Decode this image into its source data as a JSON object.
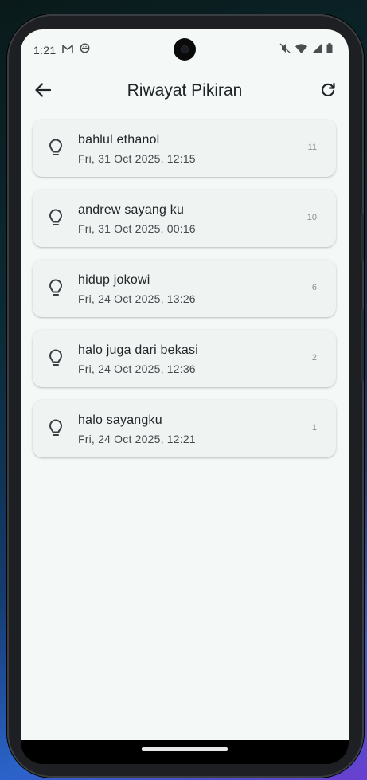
{
  "status_bar": {
    "time": "1:21"
  },
  "app_bar": {
    "title": "Riwayat Pikiran"
  },
  "thoughts": [
    {
      "title": "bahlul ethanol",
      "date": "Fri, 31 Oct 2025, 12:15",
      "count": "11"
    },
    {
      "title": "andrew sayang ku",
      "date": "Fri, 31 Oct 2025, 00:16",
      "count": "10"
    },
    {
      "title": "hidup jokowi",
      "date": "Fri, 24 Oct 2025, 13:26",
      "count": "6"
    },
    {
      "title": "halo juga dari bekasi",
      "date": "Fri, 24 Oct 2025, 12:36",
      "count": "2"
    },
    {
      "title": "halo sayangku",
      "date": "Fri, 24 Oct 2025, 12:21",
      "count": "1"
    }
  ],
  "icons": {
    "back": "arrow-left-icon",
    "refresh": "refresh-icon",
    "item": "lightbulb-icon",
    "status": [
      "gmail-icon",
      "android-icon",
      "mute-icon",
      "wifi-icon",
      "signal-icon",
      "battery-icon"
    ]
  },
  "colors": {
    "background": "#f4f9f8",
    "card": "#eff3f2",
    "text": "#1f2427"
  }
}
